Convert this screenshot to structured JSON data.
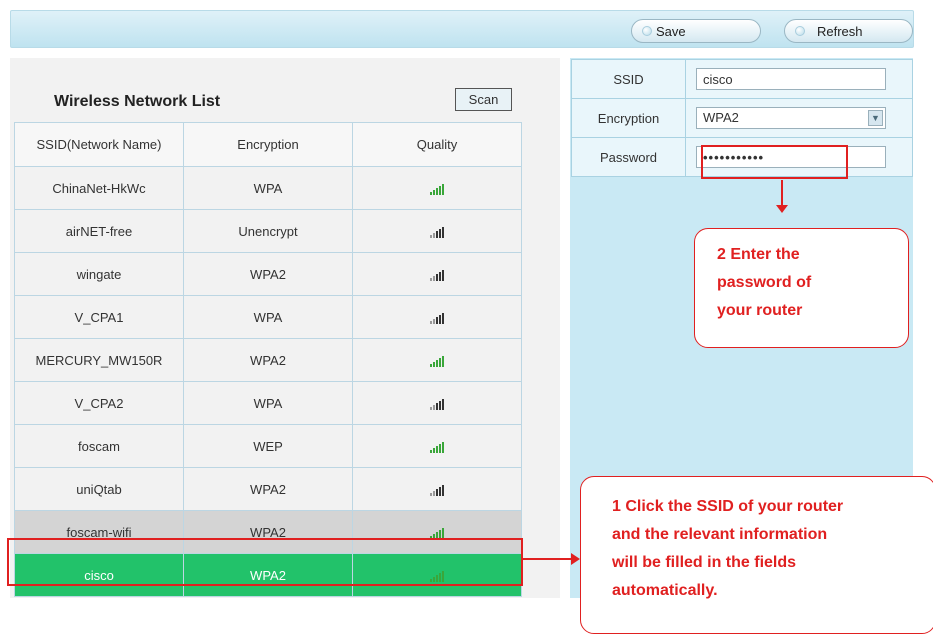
{
  "toolbar": {
    "save_label": "Save",
    "refresh_label": "Refresh"
  },
  "wireless_list": {
    "title": "Wireless Network List",
    "scan_label": "Scan",
    "columns": [
      "SSID(Network Name)",
      "Encryption",
      "Quality"
    ],
    "rows": [
      {
        "ssid": "ChinaNet-HkWc",
        "encryption": "WPA",
        "signal": "signal-strong-icon"
      },
      {
        "ssid": "airNET-free",
        "encryption": "Unencrypt",
        "signal": "signal-medium-icon"
      },
      {
        "ssid": "wingate",
        "encryption": "WPA2",
        "signal": "signal-medium-icon"
      },
      {
        "ssid": "V_CPA1",
        "encryption": "WPA",
        "signal": "signal-medium-icon"
      },
      {
        "ssid": "MERCURY_MW150R",
        "encryption": "WPA2",
        "signal": "signal-strong-icon"
      },
      {
        "ssid": "V_CPA2",
        "encryption": "WPA",
        "signal": "signal-medium-icon"
      },
      {
        "ssid": "foscam",
        "encryption": "WEP",
        "signal": "signal-strong-icon"
      },
      {
        "ssid": "uniQtab",
        "encryption": "WPA2",
        "signal": "signal-medium-icon"
      },
      {
        "ssid": "foscam-wifi",
        "encryption": "WPA2",
        "signal": "signal-strong-icon"
      },
      {
        "ssid": "cisco",
        "encryption": "WPA2",
        "signal": "signal-strong-icon"
      }
    ]
  },
  "form": {
    "ssid_label": "SSID",
    "ssid_value": "cisco",
    "encryption_label": "Encryption",
    "encryption_value": "WPA2",
    "password_label": "Password",
    "password_value": "•••••••••••"
  },
  "callouts": {
    "step2_lines": [
      "2 Enter the",
      "password of",
      "your router"
    ],
    "step1_lines": [
      "1 Click the SSID of your router",
      "and the relevant information",
      "will be filled in the fields",
      "automatically."
    ]
  },
  "colors": {
    "highlight_red": "#e02020",
    "selected_row_green": "#22c26a",
    "panel_blue": "#c9e9f4",
    "signal_green": "#3aa63a",
    "signal_dark": "#333333"
  }
}
